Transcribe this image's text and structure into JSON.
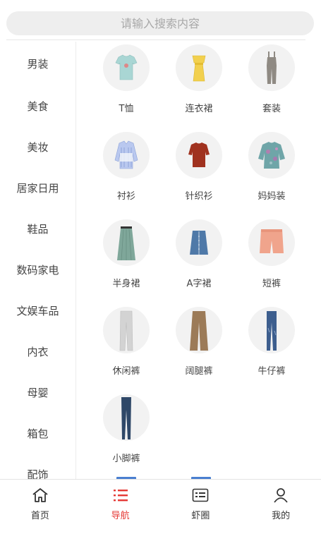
{
  "search": {
    "placeholder": "请输入搜索内容"
  },
  "sidebar": {
    "items": [
      {
        "label": "男装"
      },
      {
        "label": "美食"
      },
      {
        "label": "美妆"
      },
      {
        "label": "居家日用"
      },
      {
        "label": "鞋品"
      },
      {
        "label": "数码家电"
      },
      {
        "label": "文娱车品"
      },
      {
        "label": "内衣"
      },
      {
        "label": "母婴"
      },
      {
        "label": "箱包"
      },
      {
        "label": "配饰"
      }
    ]
  },
  "categories": [
    {
      "label": "T恤",
      "icon": "tshirt-icon",
      "color": "#a9d6d4"
    },
    {
      "label": "连衣裙",
      "icon": "yellow-dress-icon",
      "color": "#f2d04e"
    },
    {
      "label": "套装",
      "icon": "jumpsuit-icon",
      "color": "#8f8a83"
    },
    {
      "label": "衬衫",
      "icon": "striped-shirt-icon",
      "color": "#9fb3e6"
    },
    {
      "label": "针织衫",
      "icon": "knit-sweater-icon",
      "color": "#a0321f"
    },
    {
      "label": "妈妈装",
      "icon": "print-blouse-icon",
      "color": "#6fa5a8"
    },
    {
      "label": "半身裙",
      "icon": "pleated-skirt-icon",
      "color": "#7fa79a"
    },
    {
      "label": "A字裙",
      "icon": "denim-skirt-icon",
      "color": "#4f79a8"
    },
    {
      "label": "短裤",
      "icon": "shorts-icon",
      "color": "#f0a48c"
    },
    {
      "label": "休闲裤",
      "icon": "casual-pants-icon",
      "color": "#d3d3d3"
    },
    {
      "label": "阔腿裤",
      "icon": "wide-pants-icon",
      "color": "#9c7b58"
    },
    {
      "label": "牛仔裤",
      "icon": "jeans-icon",
      "color": "#3d5e8e"
    },
    {
      "label": "小脚裤",
      "icon": "skinny-pants-icon",
      "color": "#2f4868"
    }
  ],
  "tabbar": {
    "active_color": "#e53935",
    "tabs": [
      {
        "label": "首页",
        "icon": "home-icon"
      },
      {
        "label": "导航",
        "icon": "list-icon"
      },
      {
        "label": "虾圈",
        "icon": "card-icon"
      },
      {
        "label": "我的",
        "icon": "user-icon"
      }
    ]
  }
}
